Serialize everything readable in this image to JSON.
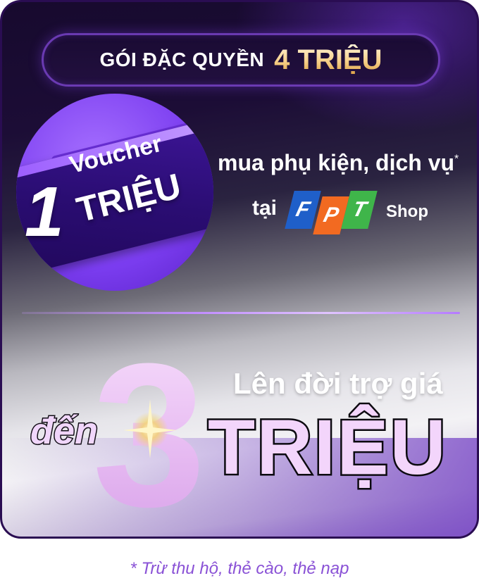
{
  "title": {
    "text": "GÓI ĐẶC QUYỀN",
    "amount": "4 TRIỆU"
  },
  "voucher": {
    "number": "1",
    "word": "Voucher",
    "unit": "TRIỆU"
  },
  "offer": {
    "line1": "mua phụ kiện, dịch vụ",
    "asterisk": "*",
    "at": "tại",
    "logo_letters": [
      "F",
      "P",
      "T"
    ],
    "shop": "Shop"
  },
  "subsidy": {
    "line": "Lên đời trợ giá",
    "prefix": "đến",
    "number": "3",
    "unit": "TRIỆU"
  },
  "footnote": "* Trừ thu hộ, thẻ cào, thẻ nạp",
  "colors": {
    "fpt_blue": "#1f5fc9",
    "fpt_orange": "#f26a21",
    "fpt_green": "#3fb54a",
    "accent_purple": "#7b3df0",
    "footnote_purple": "#8a52d6"
  }
}
